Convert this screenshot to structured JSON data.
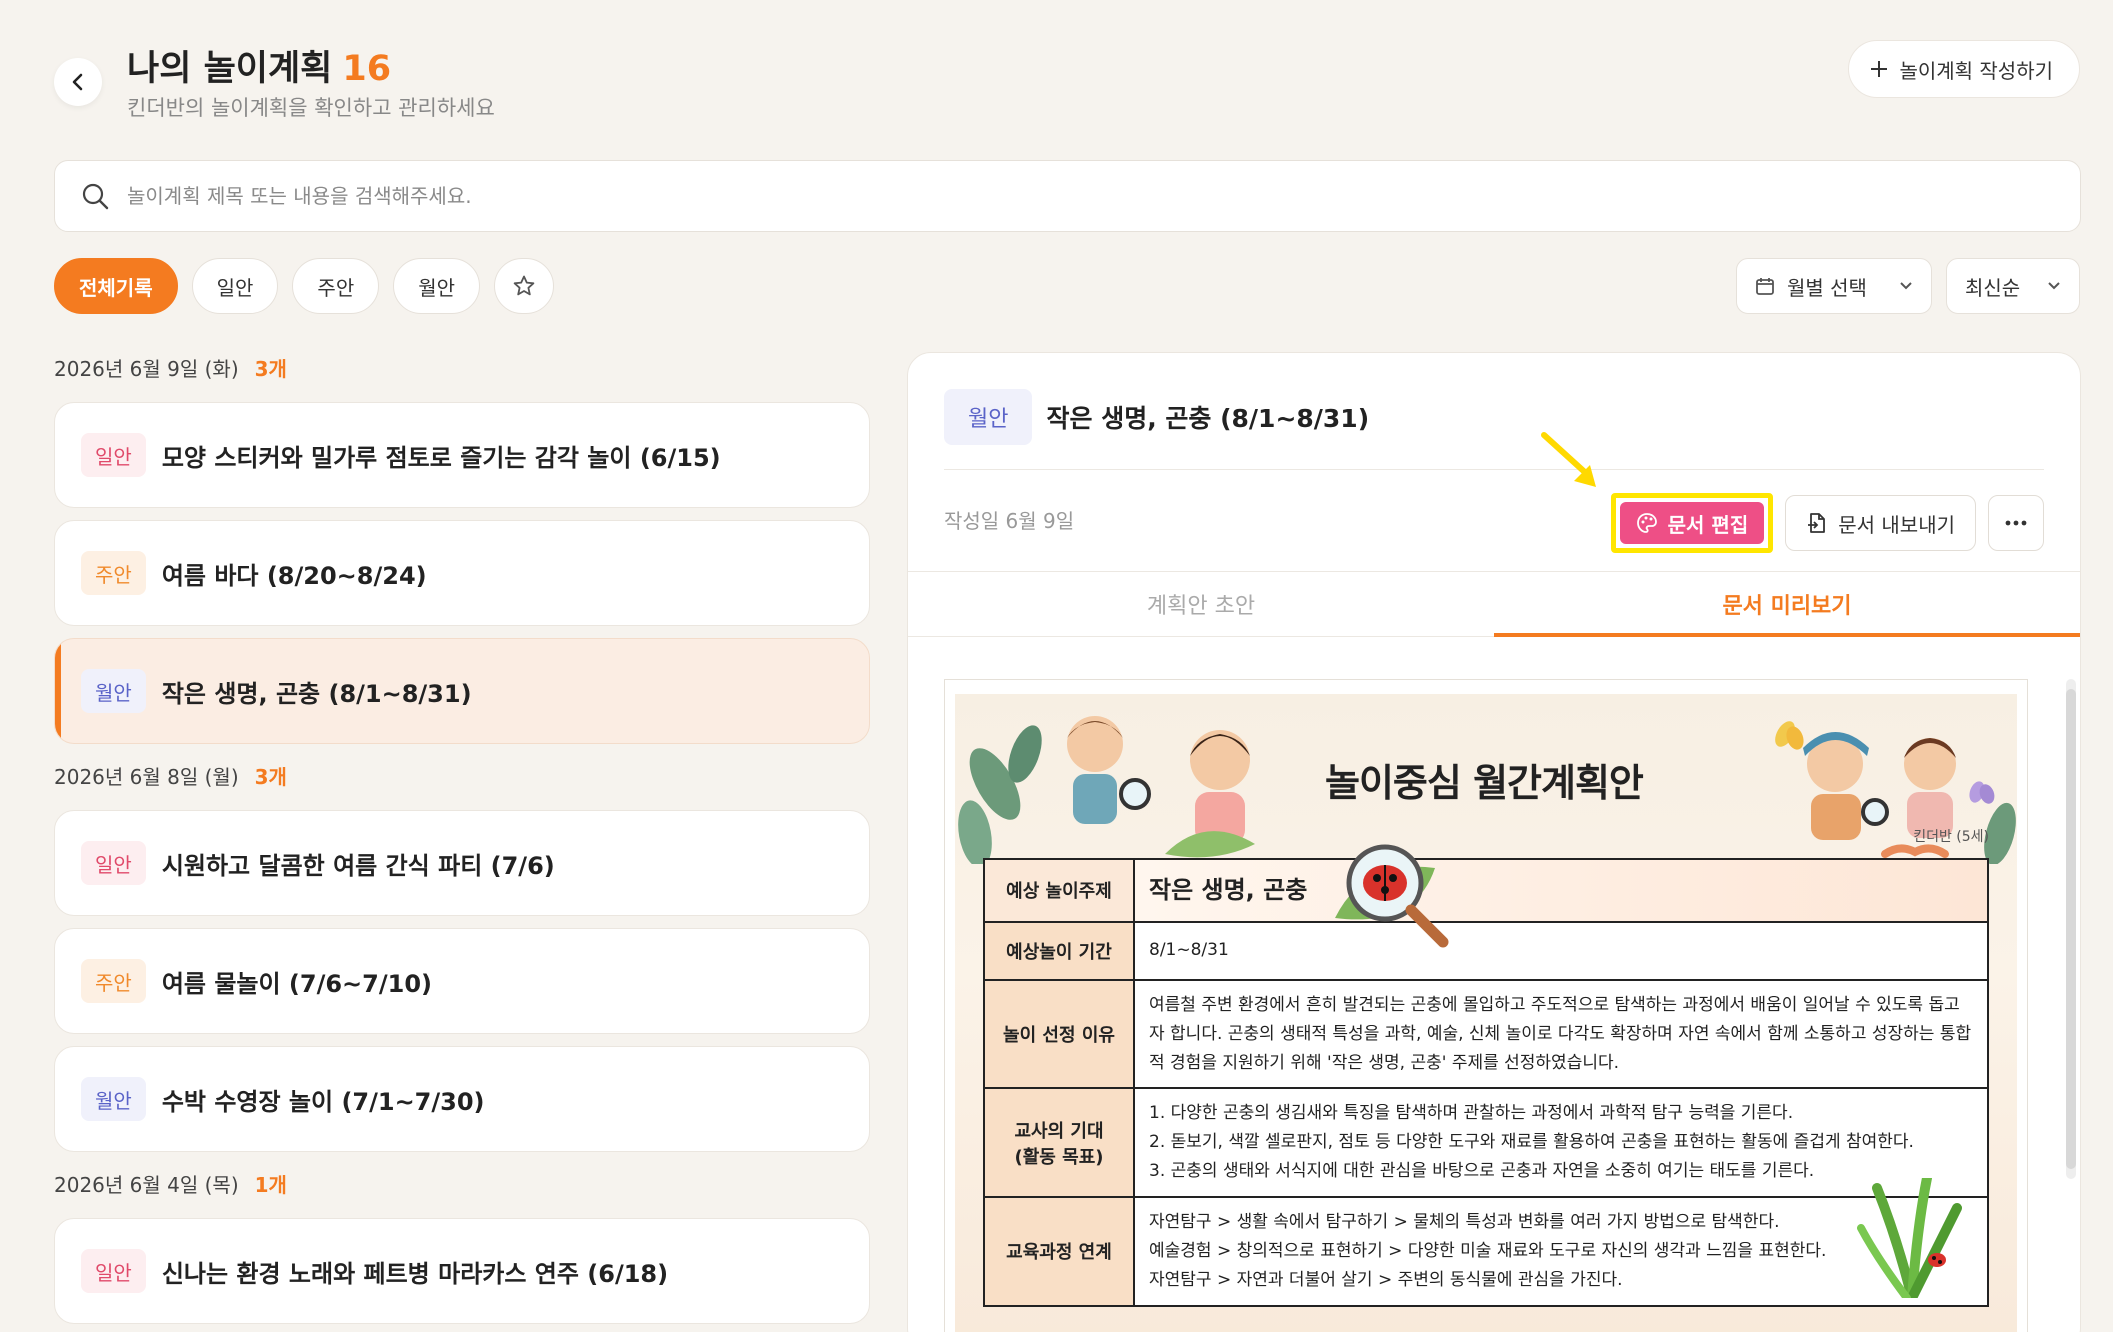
{
  "header": {
    "title": "나의 놀이계획",
    "count": "16",
    "subtitle": "킨더반의 놀이계획을 확인하고 관리하세요",
    "create_label": "놀이계획 작성하기"
  },
  "search": {
    "placeholder": "놀이계획 제목 또는 내용을 검색해주세요."
  },
  "filters": [
    {
      "label": "전체기록",
      "active": true
    },
    {
      "label": "일안"
    },
    {
      "label": "주안"
    },
    {
      "label": "월안"
    }
  ],
  "sort": {
    "month_label": "월별 선택",
    "order_label": "최신순"
  },
  "groups": [
    {
      "date": "2026년 6월 9일 (화)",
      "count": "3개",
      "items": [
        {
          "badge": "일안",
          "title": "모양 스티커와 밀가루 점토로 즐기는 감각 놀이 (6/15)"
        },
        {
          "badge": "주안",
          "title": "여름 바다 (8/20~8/24)"
        },
        {
          "badge": "월안",
          "title": "작은 생명, 곤충 (8/1~8/31)"
        }
      ]
    },
    {
      "date": "2026년 6월 8일 (월)",
      "count": "3개",
      "items": [
        {
          "badge": "일안",
          "title": "시원하고 달콤한 여름 간식 파티 (7/6)"
        },
        {
          "badge": "주안",
          "title": "여름 물놀이 (7/6~7/10)"
        },
        {
          "badge": "월안",
          "title": "수박 수영장 놀이 (7/1~7/30)"
        }
      ]
    },
    {
      "date": "2026년 6월 4일 (목)",
      "count": "1개",
      "items": [
        {
          "badge": "일안",
          "title": "신나는 환경 노래와 페트병 마라카스 연주 (6/18)"
        }
      ]
    }
  ],
  "detail": {
    "badge": "월안",
    "title": "작은 생명, 곤충 (8/1~8/31)",
    "created": "작성일 6월 9일",
    "edit_label": "문서 편집",
    "export_label": "문서 내보내기",
    "tabs": [
      {
        "label": "계획안 초안"
      },
      {
        "label": "문서 미리보기",
        "active": true
      }
    ]
  },
  "document": {
    "title": "놀이중심 월간계획안",
    "class_label": "킨더반 (5세)",
    "rows": [
      {
        "label": "예상 놀이주제",
        "value": "작은 생명, 곤충"
      },
      {
        "label": "예상놀이 기간",
        "value": "8/1~8/31"
      },
      {
        "label": "놀이 선정 이유",
        "value": "여름철 주변 환경에서 흔히 발견되는 곤충에 몰입하고 주도적으로 탐색하는 과정에서 배움이 일어날 수 있도록 돕고자 합니다. 곤충의 생태적 특성을 과학, 예술, 신체 놀이로 다각도 확장하며 자연 속에서 함께 소통하고 성장하는 통합적 경험을 지원하기 위해 '작은 생명, 곤충' 주제를 선정하였습니다."
      },
      {
        "label": "교사의 기대",
        "label2": "(활동 목표)",
        "lines": [
          "1. 다양한 곤충의 생김새와 특징을 탐색하며 관찰하는 과정에서 과학적 탐구 능력을 기른다.",
          "2. 돋보기, 색깔 셀로판지, 점토 등 다양한 도구와 재료를 활용하여 곤충을 표현하는 활동에 즐겁게 참여한다.",
          "3. 곤충의 생태와 서식지에 대한 관심을 바탕으로 곤충과 자연을 소중히 여기는 태도를 기른다."
        ]
      },
      {
        "label": "교육과정 연계",
        "lines": [
          "자연탐구 > 생활 속에서 탐구하기 > 물체의 특성과 변화를 여러 가지 방법으로 탐색한다.",
          "예술경험 > 창의적으로 표현하기 > 다양한 미술 재료와 도구로 자신의 생각과 느낌을 표현한다.",
          "자연탐구 > 자연과 더불어 살기 > 주변의 동식물에 관심을 가진다."
        ]
      }
    ]
  },
  "colors": {
    "accent": "#f47b20",
    "edit_button": "#ee4f86",
    "highlight": "#ffe600"
  }
}
